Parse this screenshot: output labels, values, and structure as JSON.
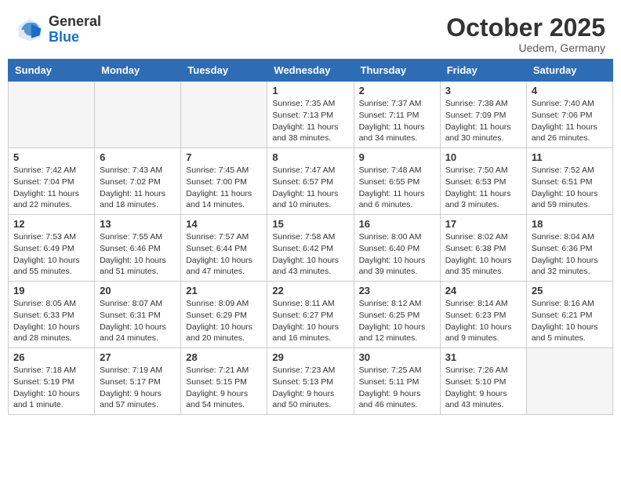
{
  "header": {
    "logo_general": "General",
    "logo_blue": "Blue",
    "month": "October 2025",
    "location": "Uedem, Germany"
  },
  "days_of_week": [
    "Sunday",
    "Monday",
    "Tuesday",
    "Wednesday",
    "Thursday",
    "Friday",
    "Saturday"
  ],
  "weeks": [
    [
      {
        "day": "",
        "info": ""
      },
      {
        "day": "",
        "info": ""
      },
      {
        "day": "",
        "info": ""
      },
      {
        "day": "1",
        "info": "Sunrise: 7:35 AM\nSunset: 7:13 PM\nDaylight: 11 hours and 38 minutes."
      },
      {
        "day": "2",
        "info": "Sunrise: 7:37 AM\nSunset: 7:11 PM\nDaylight: 11 hours and 34 minutes."
      },
      {
        "day": "3",
        "info": "Sunrise: 7:38 AM\nSunset: 7:09 PM\nDaylight: 11 hours and 30 minutes."
      },
      {
        "day": "4",
        "info": "Sunrise: 7:40 AM\nSunset: 7:06 PM\nDaylight: 11 hours and 26 minutes."
      }
    ],
    [
      {
        "day": "5",
        "info": "Sunrise: 7:42 AM\nSunset: 7:04 PM\nDaylight: 11 hours and 22 minutes."
      },
      {
        "day": "6",
        "info": "Sunrise: 7:43 AM\nSunset: 7:02 PM\nDaylight: 11 hours and 18 minutes."
      },
      {
        "day": "7",
        "info": "Sunrise: 7:45 AM\nSunset: 7:00 PM\nDaylight: 11 hours and 14 minutes."
      },
      {
        "day": "8",
        "info": "Sunrise: 7:47 AM\nSunset: 6:57 PM\nDaylight: 11 hours and 10 minutes."
      },
      {
        "day": "9",
        "info": "Sunrise: 7:48 AM\nSunset: 6:55 PM\nDaylight: 11 hours and 6 minutes."
      },
      {
        "day": "10",
        "info": "Sunrise: 7:50 AM\nSunset: 6:53 PM\nDaylight: 11 hours and 3 minutes."
      },
      {
        "day": "11",
        "info": "Sunrise: 7:52 AM\nSunset: 6:51 PM\nDaylight: 10 hours and 59 minutes."
      }
    ],
    [
      {
        "day": "12",
        "info": "Sunrise: 7:53 AM\nSunset: 6:49 PM\nDaylight: 10 hours and 55 minutes."
      },
      {
        "day": "13",
        "info": "Sunrise: 7:55 AM\nSunset: 6:46 PM\nDaylight: 10 hours and 51 minutes."
      },
      {
        "day": "14",
        "info": "Sunrise: 7:57 AM\nSunset: 6:44 PM\nDaylight: 10 hours and 47 minutes."
      },
      {
        "day": "15",
        "info": "Sunrise: 7:58 AM\nSunset: 6:42 PM\nDaylight: 10 hours and 43 minutes."
      },
      {
        "day": "16",
        "info": "Sunrise: 8:00 AM\nSunset: 6:40 PM\nDaylight: 10 hours and 39 minutes."
      },
      {
        "day": "17",
        "info": "Sunrise: 8:02 AM\nSunset: 6:38 PM\nDaylight: 10 hours and 35 minutes."
      },
      {
        "day": "18",
        "info": "Sunrise: 8:04 AM\nSunset: 6:36 PM\nDaylight: 10 hours and 32 minutes."
      }
    ],
    [
      {
        "day": "19",
        "info": "Sunrise: 8:05 AM\nSunset: 6:33 PM\nDaylight: 10 hours and 28 minutes."
      },
      {
        "day": "20",
        "info": "Sunrise: 8:07 AM\nSunset: 6:31 PM\nDaylight: 10 hours and 24 minutes."
      },
      {
        "day": "21",
        "info": "Sunrise: 8:09 AM\nSunset: 6:29 PM\nDaylight: 10 hours and 20 minutes."
      },
      {
        "day": "22",
        "info": "Sunrise: 8:11 AM\nSunset: 6:27 PM\nDaylight: 10 hours and 16 minutes."
      },
      {
        "day": "23",
        "info": "Sunrise: 8:12 AM\nSunset: 6:25 PM\nDaylight: 10 hours and 12 minutes."
      },
      {
        "day": "24",
        "info": "Sunrise: 8:14 AM\nSunset: 6:23 PM\nDaylight: 10 hours and 9 minutes."
      },
      {
        "day": "25",
        "info": "Sunrise: 8:16 AM\nSunset: 6:21 PM\nDaylight: 10 hours and 5 minutes."
      }
    ],
    [
      {
        "day": "26",
        "info": "Sunrise: 7:18 AM\nSunset: 5:19 PM\nDaylight: 10 hours and 1 minute."
      },
      {
        "day": "27",
        "info": "Sunrise: 7:19 AM\nSunset: 5:17 PM\nDaylight: 9 hours and 57 minutes."
      },
      {
        "day": "28",
        "info": "Sunrise: 7:21 AM\nSunset: 5:15 PM\nDaylight: 9 hours and 54 minutes."
      },
      {
        "day": "29",
        "info": "Sunrise: 7:23 AM\nSunset: 5:13 PM\nDaylight: 9 hours and 50 minutes."
      },
      {
        "day": "30",
        "info": "Sunrise: 7:25 AM\nSunset: 5:11 PM\nDaylight: 9 hours and 46 minutes."
      },
      {
        "day": "31",
        "info": "Sunrise: 7:26 AM\nSunset: 5:10 PM\nDaylight: 9 hours and 43 minutes."
      },
      {
        "day": "",
        "info": ""
      }
    ]
  ]
}
